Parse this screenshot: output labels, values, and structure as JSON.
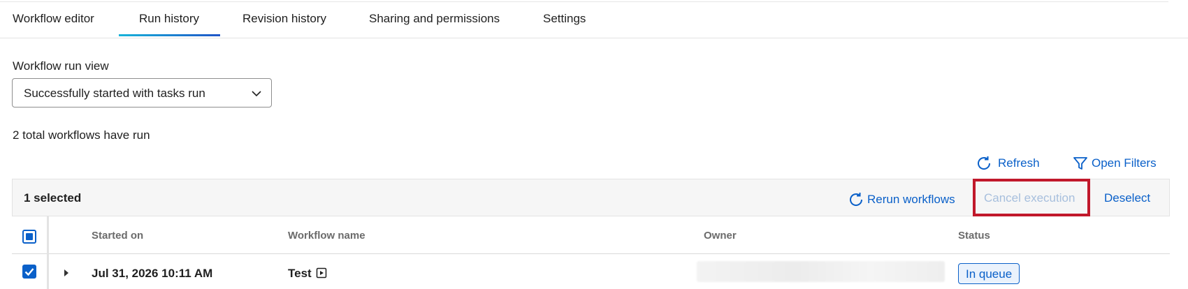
{
  "tabs": [
    {
      "label": "Workflow editor"
    },
    {
      "label": "Run history",
      "active": true
    },
    {
      "label": "Revision history"
    },
    {
      "label": "Sharing and permissions"
    },
    {
      "label": "Settings"
    }
  ],
  "run_view": {
    "label": "Workflow run view",
    "selected": "Successfully started with tasks run"
  },
  "summary": "2 total workflows have run",
  "toolbar": {
    "refresh_label": "Refresh",
    "open_filters_label": "Open Filters"
  },
  "selection_bar": {
    "count_label": "1 selected",
    "rerun_label": "Rerun workflows",
    "cancel_label": "Cancel execution",
    "deselect_label": "Deselect"
  },
  "table": {
    "columns": [
      "Started on",
      "Workflow name",
      "Owner",
      "Status"
    ],
    "rows": [
      {
        "started_on": "Jul 31, 2026 10:11 AM",
        "workflow_name": "Test",
        "status": "In queue",
        "selected": true
      }
    ]
  },
  "colors": {
    "accent": "#0a60c9",
    "highlight": "#c1182b",
    "disabled_text": "#a7bfdd"
  }
}
